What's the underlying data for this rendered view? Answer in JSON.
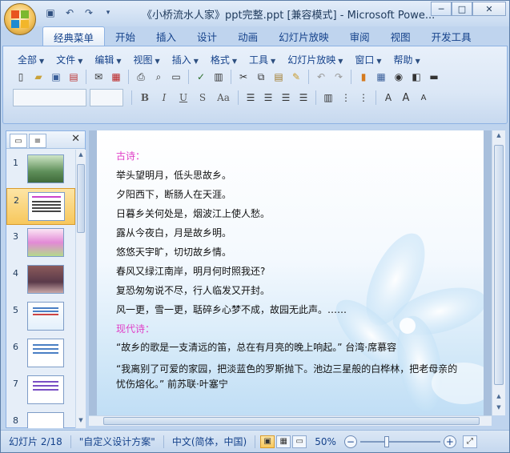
{
  "window": {
    "title": "《小桥流水人家》ppt完整.ppt [兼容模式] - Microsoft Powe..."
  },
  "ribbon_tabs": [
    "经典菜单",
    "开始",
    "插入",
    "设计",
    "动画",
    "幻灯片放映",
    "审阅",
    "视图",
    "开发工具"
  ],
  "classic_menus": [
    "全部",
    "文件",
    "编辑",
    "视图",
    "插入",
    "格式",
    "工具",
    "幻灯片放映",
    "窗口",
    "帮助"
  ],
  "font_buttons": [
    "B",
    "I",
    "U",
    "S",
    "Aa"
  ],
  "thumbnails": [
    {
      "num": "1",
      "selected": false
    },
    {
      "num": "2",
      "selected": true
    },
    {
      "num": "3",
      "selected": false
    },
    {
      "num": "4",
      "selected": false
    },
    {
      "num": "5",
      "selected": false
    },
    {
      "num": "6",
      "selected": false
    },
    {
      "num": "7",
      "selected": false
    },
    {
      "num": "8",
      "selected": false
    }
  ],
  "slide": {
    "heading_ancient": "古诗：",
    "ancient_lines": [
      "举头望明月，低头思故乡。",
      "夕阳西下，断肠人在天涯。",
      "日暮乡关何处是，烟波江上使人愁。",
      "露从今夜白，月是故乡明。",
      "悠悠天宇旷，切切故乡情。",
      "春风又绿江南岸，明月何时照我还?",
      "复恐匆匆说不尽，行人临发又开封。",
      "风一更，雪一更，聒碎乡心梦不成，故园无此声。……"
    ],
    "heading_modern": "现代诗：",
    "modern_lines": [
      "“故乡的歌是一支清远的笛，总在有月亮的晚上响起。” 台湾·席慕容",
      "“我离别了可爱的家园，把淡蓝色的罗斯抛下。池边三星般的白桦林，把老母亲的忧伤熔化。”    前苏联·叶塞宁"
    ]
  },
  "status": {
    "slide_pos": "幻灯片 2/18",
    "theme": "\"自定义设计方案\"",
    "language": "中文(简体，中国)",
    "zoom": "50%"
  },
  "colors": {
    "heading": "#e040c8",
    "accent": "#15428b",
    "selected": "#f7c75c"
  }
}
